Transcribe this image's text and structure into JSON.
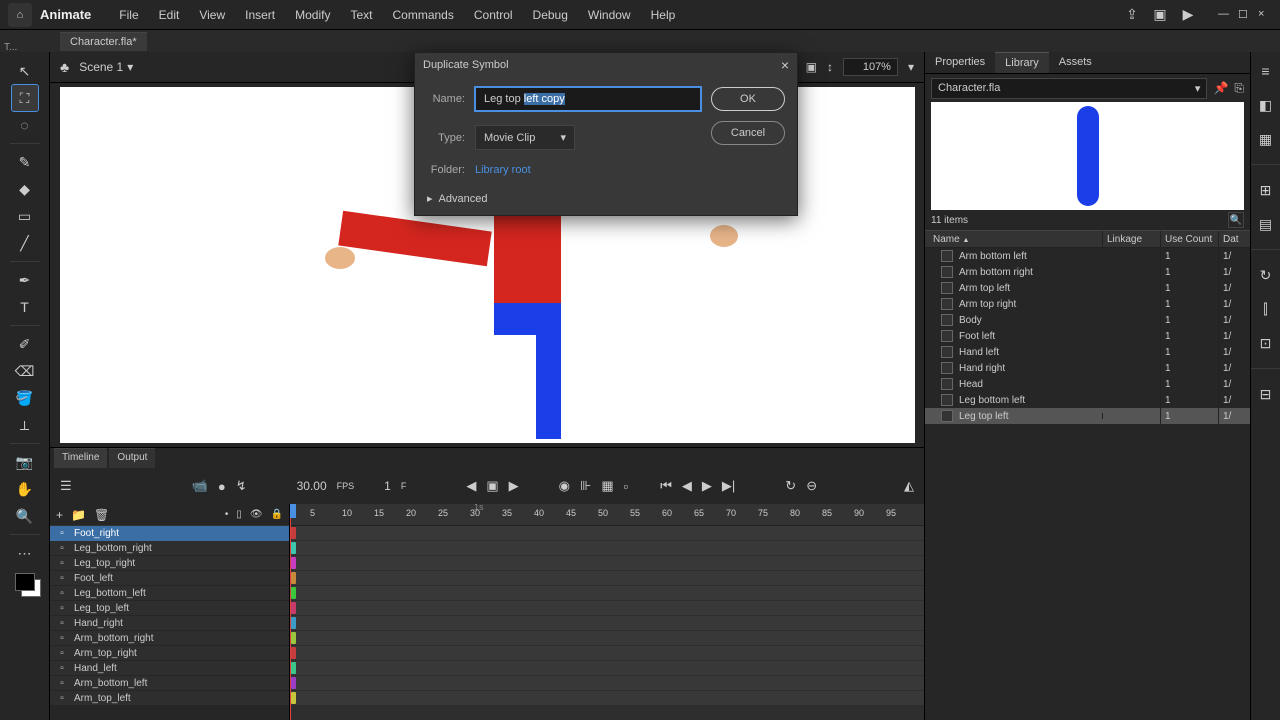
{
  "app_title": "Animate",
  "menu": [
    "File",
    "Edit",
    "View",
    "Insert",
    "Modify",
    "Text",
    "Commands",
    "Control",
    "Debug",
    "Window",
    "Help"
  ],
  "tab": "Character.fla*",
  "scene": "Scene 1",
  "zoom": "107%",
  "modal": {
    "title": "Duplicate Symbol",
    "name_label": "Name:",
    "name_value_pre": "Leg top ",
    "name_value_sel": "left copy",
    "type_label": "Type:",
    "type_value": "Movie Clip",
    "folder_label": "Folder:",
    "folder_value": "Library root",
    "advanced": "Advanced",
    "ok": "OK",
    "cancel": "Cancel"
  },
  "timeline": {
    "tabs": [
      "Timeline",
      "Output"
    ],
    "fps_val": "30.00",
    "fps_lbl": "FPS",
    "frame_val": "1",
    "frame_lbl": "F"
  },
  "layers": [
    {
      "name": "Foot_right",
      "c": "#c73c3c",
      "sel": true
    },
    {
      "name": "Leg_bottom_right",
      "c": "#3cc7ac"
    },
    {
      "name": "Leg_top_right",
      "c": "#c73cc0"
    },
    {
      "name": "Foot_left",
      "c": "#c78a3c"
    },
    {
      "name": "Leg_bottom_left",
      "c": "#3cc73c"
    },
    {
      "name": "Leg_top_left",
      "c": "#c73c6b"
    },
    {
      "name": "Hand_right",
      "c": "#3c9cc7"
    },
    {
      "name": "Arm_bottom_right",
      "c": "#9cc73c"
    },
    {
      "name": "Arm_top_right",
      "c": "#c73c3c"
    },
    {
      "name": "Hand_left",
      "c": "#3cc789"
    },
    {
      "name": "Arm_bottom_left",
      "c": "#9c3cc7"
    },
    {
      "name": "Arm_top_left",
      "c": "#c7c73c"
    }
  ],
  "ruler_ticks": [
    "5",
    "10",
    "15",
    "20",
    "25",
    "30",
    "35",
    "40",
    "45",
    "50",
    "55",
    "60",
    "65",
    "70",
    "75",
    "80",
    "85",
    "90",
    "95"
  ],
  "ruler_sec": "1s",
  "right_panel": {
    "tabs": [
      "Properties",
      "Library",
      "Assets"
    ],
    "source": "Character.fla",
    "items_count": "11 items",
    "headers": {
      "name": "Name",
      "linkage": "Linkage",
      "usecount": "Use Count",
      "date": "Dat"
    }
  },
  "lib_items": [
    {
      "name": "Arm bottom left",
      "use": "1",
      "date": "1/"
    },
    {
      "name": "Arm bottom right",
      "use": "1",
      "date": "1/"
    },
    {
      "name": "Arm top left",
      "use": "1",
      "date": "1/"
    },
    {
      "name": "Arm top right",
      "use": "1",
      "date": "1/"
    },
    {
      "name": "Body",
      "use": "1",
      "date": "1/"
    },
    {
      "name": "Foot left",
      "use": "1",
      "date": "1/"
    },
    {
      "name": "Hand left",
      "use": "1",
      "date": "1/"
    },
    {
      "name": "Hand right",
      "use": "1",
      "date": "1/"
    },
    {
      "name": "Head",
      "use": "1",
      "date": "1/"
    },
    {
      "name": "Leg bottom left",
      "use": "1",
      "date": "1/"
    },
    {
      "name": "Leg top left",
      "use": "1",
      "date": "1/",
      "sel": true
    }
  ],
  "glyph": {
    "caret_down": "▾",
    "caret_right": "▸",
    "close": "×",
    "share": "⇪",
    "panels": "▣",
    "play": "▶",
    "min": "—",
    "max": "☐",
    "arrow": "↖",
    "transform": "⛶",
    "lasso": "◌",
    "brush": "✎",
    "shape": "◆",
    "rect": "▭",
    "line": "╱",
    "pen": "✒",
    "text": "T",
    "eyedrop": "✐",
    "eraser": "⌫",
    "paint": "🪣",
    "bone": "⟂",
    "camera": "📷",
    "hand": "✋",
    "magnify": "🔍",
    "home": "⌂",
    "layers_ic": "☰",
    "cam": "📹",
    "mic": "●",
    "graph": "↯",
    "first": "⏮",
    "prevk": "▣",
    "next": "▶",
    "loop": "↻",
    "onion": "◌",
    "plus": "+",
    "folder": "📁",
    "trash": "🗑",
    "dot": "•",
    "eye": "👁",
    "lock": "🔒",
    "search": "🔍",
    "pin": "📌",
    "link": "⎘",
    "arrow_sort": "▲",
    "fit": "⊞",
    "stage": "🎬"
  }
}
